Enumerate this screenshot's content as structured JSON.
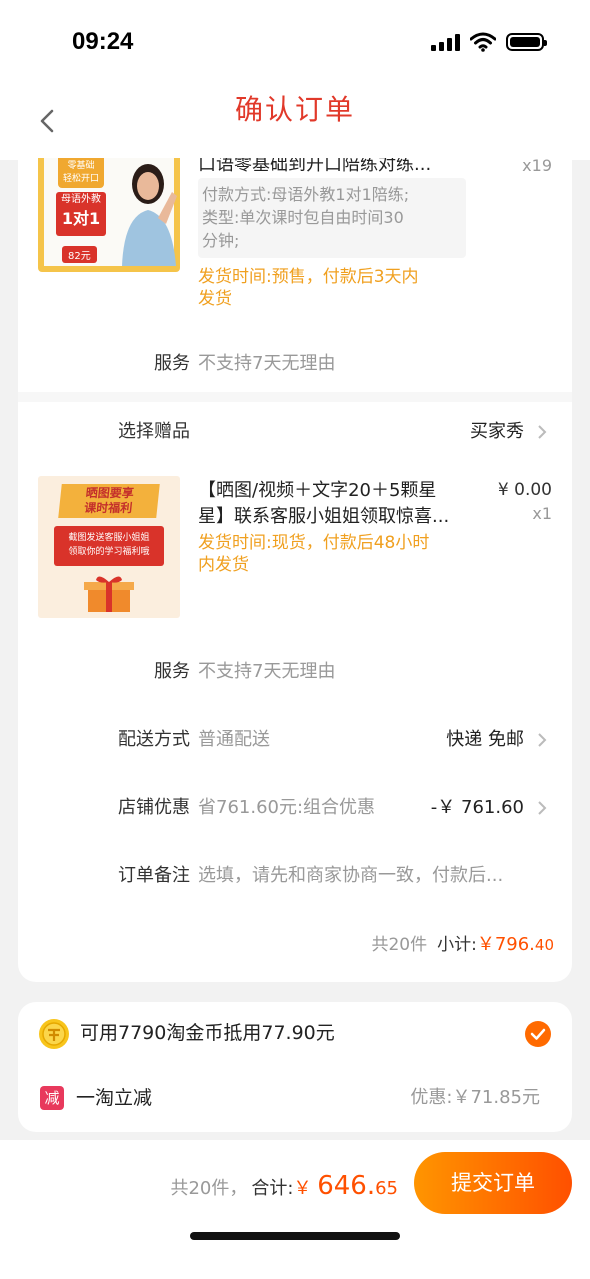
{
  "status_bar": {
    "time": "09:24"
  },
  "header": {
    "title": "确认订单"
  },
  "item1": {
    "title": "口语零基础到开口陪练对练...",
    "quantity": "x19",
    "spec_lines": [
      "付款方式:母语外教1对1陪练;",
      "类型:单次课时包自由时间30",
      "分钟;"
    ],
    "shipping_lines": [
      "发货时间:预售，付款后3天内",
      "发货"
    ],
    "thumb": {
      "tag_line1": "零基础",
      "tag_line2": "轻松开口",
      "box_line1": "母语外教",
      "box_line2": "1对1",
      "price": "82元"
    }
  },
  "service1": {
    "label": "服务",
    "value": "不支持7天无理由"
  },
  "gift": {
    "label": "选择赠品",
    "value": "买家秀"
  },
  "item2": {
    "title_lines": [
      "【晒图/视频＋文字20＋5颗星",
      "星】联系客服小姐姐领取惊喜..."
    ],
    "price": "¥ 0.00",
    "quantity": "x1",
    "shipping_lines": [
      "发货时间:现货，付款后48小时",
      "内发货"
    ],
    "thumb": {
      "banner_line1": "晒图要享",
      "banner_line2": "课时福利",
      "red_line1": "截图发送客服小姐姐",
      "red_line2": "领取你的学习福利哦"
    }
  },
  "service2": {
    "label": "服务",
    "value": "不支持7天无理由"
  },
  "delivery": {
    "label": "配送方式",
    "value": "普通配送",
    "right": "快递 免邮"
  },
  "discount": {
    "label": "店铺优惠",
    "value": "省761.60元:组合优惠",
    "right": "-￥ 761.60"
  },
  "note": {
    "label": "订单备注",
    "placeholder": "选填，请先和商家协商一致，付款后..."
  },
  "subtotal": {
    "count": "共20件",
    "label": "小计:",
    "amount": "￥796.",
    "decimal": "40"
  },
  "coins": {
    "text": "可用7790淘金币抵用77.90元"
  },
  "yitao": {
    "icon": "减",
    "label": "一淘立减",
    "value": "优惠:￥71.85元"
  },
  "footer": {
    "count": "共20件，",
    "label": "合计:",
    "currency": "￥ ",
    "integer": "646.",
    "decimal": "65",
    "submit": "提交订单"
  },
  "colors": {
    "title": "#e1392a",
    "accent": "#ff5000",
    "shipping": "#f0a020"
  }
}
